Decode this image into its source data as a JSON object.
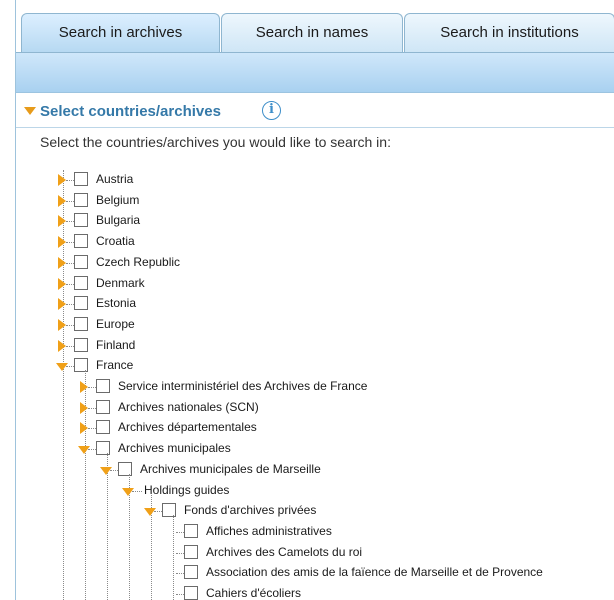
{
  "tabs": [
    {
      "label": "Search in archives"
    },
    {
      "label": "Search in names"
    },
    {
      "label": "Search in institutions"
    }
  ],
  "section": {
    "title": "Select countries/archives",
    "info_glyph": "i",
    "instruction": "Select the countries/archives you would like to search in:"
  },
  "tree": {
    "countries": [
      {
        "label": "Austria",
        "expanded": false
      },
      {
        "label": "Belgium",
        "expanded": false
      },
      {
        "label": "Bulgaria",
        "expanded": false
      },
      {
        "label": "Croatia",
        "expanded": false
      },
      {
        "label": "Czech Republic",
        "expanded": false
      },
      {
        "label": "Denmark",
        "expanded": false
      },
      {
        "label": "Estonia",
        "expanded": false
      },
      {
        "label": "Europe",
        "expanded": false
      },
      {
        "label": "Finland",
        "expanded": false
      },
      {
        "label": "France",
        "expanded": true
      }
    ],
    "france_children": [
      {
        "label": "Service interministériel des Archives de France",
        "expanded": false
      },
      {
        "label": "Archives nationales (SCN)",
        "expanded": false
      },
      {
        "label": "Archives départementales",
        "expanded": false
      },
      {
        "label": "Archives municipales",
        "expanded": true
      }
    ],
    "municipales_children": [
      {
        "label": "Archives municipales de Marseille",
        "expanded": true
      }
    ],
    "marseille_children": [
      {
        "label": "Holdings guides",
        "expanded": true
      }
    ],
    "holdings_children": [
      {
        "label": "Fonds d'archives privées",
        "expanded": true
      }
    ],
    "fonds_children": [
      {
        "label": "Affiches administratives"
      },
      {
        "label": "Archives des Camelots du roi"
      },
      {
        "label": "Association des amis de la faïence de Marseille et de Provence"
      },
      {
        "label": "Cahiers d'écoliers"
      }
    ]
  }
}
